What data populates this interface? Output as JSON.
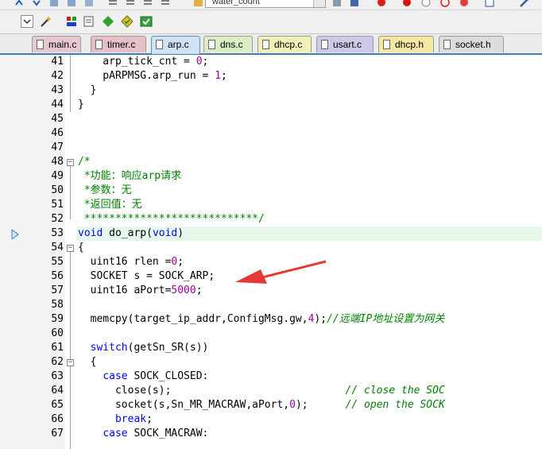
{
  "toolbar": {
    "target_dropdown_value": "water_count"
  },
  "tabs": [
    {
      "label": "main.c",
      "color": "#e8c8cf"
    },
    {
      "label": "timer.c",
      "color": "#e6c0c6"
    },
    {
      "label": "arp.c",
      "color": "#cfe3f5"
    },
    {
      "label": "dns.c",
      "color": "#d9efc2"
    },
    {
      "label": "dhcp.c",
      "color": "#f2f0b6"
    },
    {
      "label": "usart.c",
      "color": "#cfc8e6"
    },
    {
      "label": "dhcp.h",
      "color": "#f6e7a4"
    },
    {
      "label": "socket.h",
      "color": "#dcdcdc"
    }
  ],
  "active_tab": "arp.c",
  "code_lines": [
    {
      "n": "41",
      "code": "    arp_tick_cnt = 0;"
    },
    {
      "n": "42",
      "code": "    pARPMSG.arp_run = 1;"
    },
    {
      "n": "43",
      "code": "  }"
    },
    {
      "n": "44",
      "code": "}"
    },
    {
      "n": "45",
      "code": ""
    },
    {
      "n": "46",
      "code": ""
    },
    {
      "n": "47",
      "code": ""
    },
    {
      "n": "48",
      "code": "/*"
    },
    {
      "n": "49",
      "code": " *功能：响应arp请求"
    },
    {
      "n": "50",
      "code": " *参数：无"
    },
    {
      "n": "51",
      "code": " *返回值：无"
    },
    {
      "n": "52",
      "code": " ****************************/"
    },
    {
      "n": "53",
      "code": "void do_arp(void)"
    },
    {
      "n": "54",
      "code": "{"
    },
    {
      "n": "55",
      "code": "  uint16 rlen =0;"
    },
    {
      "n": "56",
      "code": "  SOCKET s = SOCK_ARP;"
    },
    {
      "n": "57",
      "code": "  uint16 aPort=5000;"
    },
    {
      "n": "58",
      "code": ""
    },
    {
      "n": "59",
      "code": "  memcpy(target_ip_addr,ConfigMsg.gw,4);//远端IP地址设置为网关"
    },
    {
      "n": "60",
      "code": ""
    },
    {
      "n": "61",
      "code": "  switch(getSn_SR(s))"
    },
    {
      "n": "62",
      "code": "  {"
    },
    {
      "n": "63",
      "code": "    case SOCK_CLOSED:"
    },
    {
      "n": "64",
      "code": "      close(s);                            // close the SOC"
    },
    {
      "n": "65",
      "code": "      socket(s,Sn_MR_MACRAW,aPort,0);      // open the SOCK"
    },
    {
      "n": "66",
      "code": "      break;"
    },
    {
      "n": "67",
      "code": "    case SOCK_MACRAW:"
    }
  ],
  "current_line": "53"
}
